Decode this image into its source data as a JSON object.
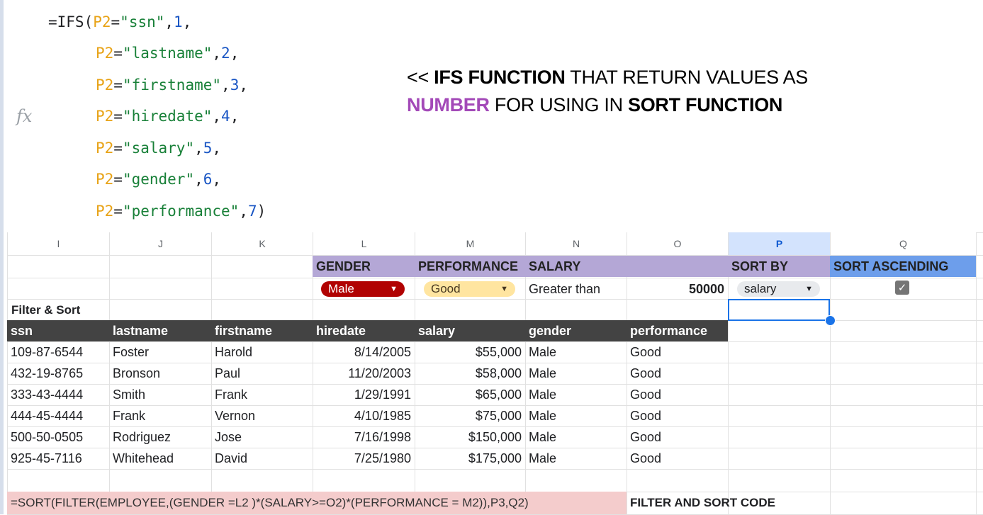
{
  "formula": {
    "fx_symbol": "fx",
    "lines": [
      {
        "parts": [
          {
            "t": "=IFS(",
            "c": "plain"
          },
          {
            "t": "P2",
            "c": "ref"
          },
          {
            "t": "=",
            "c": "plain"
          },
          {
            "t": "\"ssn\"",
            "c": "str"
          },
          {
            "t": ",",
            "c": "plain"
          },
          {
            "t": "1",
            "c": "num"
          },
          {
            "t": ",",
            "c": "plain"
          }
        ]
      },
      {
        "parts": [
          {
            "t": "P2",
            "c": "ref"
          },
          {
            "t": "=",
            "c": "plain"
          },
          {
            "t": "\"lastname\"",
            "c": "str"
          },
          {
            "t": ",",
            "c": "plain"
          },
          {
            "t": "2",
            "c": "num"
          },
          {
            "t": ",",
            "c": "plain"
          }
        ]
      },
      {
        "parts": [
          {
            "t": "P2",
            "c": "ref"
          },
          {
            "t": "=",
            "c": "plain"
          },
          {
            "t": "\"firstname\"",
            "c": "str"
          },
          {
            "t": ",",
            "c": "plain"
          },
          {
            "t": "3",
            "c": "num"
          },
          {
            "t": ",",
            "c": "plain"
          }
        ]
      },
      {
        "parts": [
          {
            "t": "P2",
            "c": "ref"
          },
          {
            "t": "=",
            "c": "plain"
          },
          {
            "t": "\"hiredate\"",
            "c": "str"
          },
          {
            "t": ",",
            "c": "plain"
          },
          {
            "t": "4",
            "c": "num"
          },
          {
            "t": ",",
            "c": "plain"
          }
        ]
      },
      {
        "parts": [
          {
            "t": "P2",
            "c": "ref"
          },
          {
            "t": "=",
            "c": "plain"
          },
          {
            "t": "\"salary\"",
            "c": "str"
          },
          {
            "t": ",",
            "c": "plain"
          },
          {
            "t": "5",
            "c": "num"
          },
          {
            "t": ",",
            "c": "plain"
          }
        ]
      },
      {
        "parts": [
          {
            "t": "P2",
            "c": "ref"
          },
          {
            "t": "=",
            "c": "plain"
          },
          {
            "t": "\"gender\"",
            "c": "str"
          },
          {
            "t": ",",
            "c": "plain"
          },
          {
            "t": "6",
            "c": "num"
          },
          {
            "t": ",",
            "c": "plain"
          }
        ]
      },
      {
        "parts": [
          {
            "t": "P2",
            "c": "ref"
          },
          {
            "t": "=",
            "c": "plain"
          },
          {
            "t": "\"performance\"",
            "c": "str"
          },
          {
            "t": ",",
            "c": "plain"
          },
          {
            "t": "7",
            "c": "num"
          },
          {
            "t": ")",
            "c": "plain"
          }
        ]
      }
    ]
  },
  "note": {
    "prefix": "<< ",
    "bold1": "IFS FUNCTION",
    "mid1": " THAT RETURN VALUES AS",
    "purple": "NUMBER",
    "mid2": " FOR USING IN ",
    "bold2": "SORT FUNCTION"
  },
  "columns": [
    "I",
    "J",
    "K",
    "L",
    "M",
    "N",
    "O",
    "P",
    "Q"
  ],
  "criteria_headers": {
    "gender": "GENDER",
    "performance": "PERFORMANCE",
    "salary": "SALARY",
    "sort_by": "SORT BY",
    "sort_ascending": "SORT ASCENDING"
  },
  "criteria_values": {
    "gender": "Male",
    "performance": "Good",
    "salary_op": "Greater than",
    "salary_value": "50000",
    "sort_by": "salary",
    "sort_ascending_checked": "✓"
  },
  "dropdown_arrow": "▼",
  "colors": {
    "male_chip": "#b10202",
    "good_chip": "#ffe5a0",
    "sortby_chip": "#e8eaed"
  },
  "section_label": "Filter & Sort",
  "table_headers": [
    "ssn",
    "lastname",
    "firstname",
    "hiredate",
    "salary",
    "gender",
    "performance"
  ],
  "rows": [
    [
      "109-87-6544",
      "Foster",
      "Harold",
      "8/14/2005",
      "$55,000",
      "Male",
      "Good"
    ],
    [
      "432-19-8765",
      "Bronson",
      "Paul",
      "11/20/2003",
      "$58,000",
      "Male",
      "Good"
    ],
    [
      "333-43-4444",
      "Smith",
      "Frank",
      "1/29/1991",
      "$65,000",
      "Male",
      "Good"
    ],
    [
      "444-45-4444",
      "Frank",
      "Vernon",
      "4/10/1985",
      "$75,000",
      "Male",
      "Good"
    ],
    [
      "500-50-0505",
      "Rodriguez",
      "Jose",
      "7/16/1998",
      "$150,000",
      "Male",
      "Good"
    ],
    [
      "925-45-7116",
      "Whitehead",
      "David",
      "7/25/1980",
      "$175,000",
      "Male",
      "Good"
    ]
  ],
  "bottom_formula": "=SORT(FILTER(EMPLOYEE,(GENDER =L2 )*(SALARY>=O2)*(PERFORMANCE = M2)),P3,Q2)",
  "bottom_label": "FILTER AND SORT CODE"
}
